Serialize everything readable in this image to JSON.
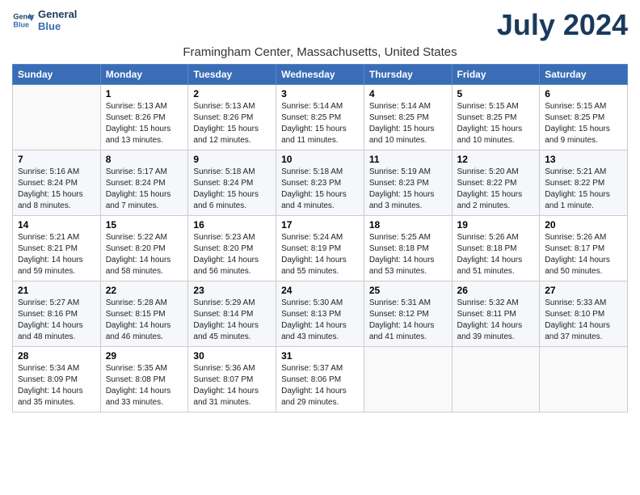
{
  "header": {
    "logo_line1": "General",
    "logo_line2": "Blue",
    "month_title": "July 2024",
    "location": "Framingham Center, Massachusetts, United States"
  },
  "days_of_week": [
    "Sunday",
    "Monday",
    "Tuesday",
    "Wednesday",
    "Thursday",
    "Friday",
    "Saturday"
  ],
  "weeks": [
    [
      {
        "day": "",
        "details": ""
      },
      {
        "day": "1",
        "details": "Sunrise: 5:13 AM\nSunset: 8:26 PM\nDaylight: 15 hours\nand 13 minutes."
      },
      {
        "day": "2",
        "details": "Sunrise: 5:13 AM\nSunset: 8:26 PM\nDaylight: 15 hours\nand 12 minutes."
      },
      {
        "day": "3",
        "details": "Sunrise: 5:14 AM\nSunset: 8:25 PM\nDaylight: 15 hours\nand 11 minutes."
      },
      {
        "day": "4",
        "details": "Sunrise: 5:14 AM\nSunset: 8:25 PM\nDaylight: 15 hours\nand 10 minutes."
      },
      {
        "day": "5",
        "details": "Sunrise: 5:15 AM\nSunset: 8:25 PM\nDaylight: 15 hours\nand 10 minutes."
      },
      {
        "day": "6",
        "details": "Sunrise: 5:15 AM\nSunset: 8:25 PM\nDaylight: 15 hours\nand 9 minutes."
      }
    ],
    [
      {
        "day": "7",
        "details": "Sunrise: 5:16 AM\nSunset: 8:24 PM\nDaylight: 15 hours\nand 8 minutes."
      },
      {
        "day": "8",
        "details": "Sunrise: 5:17 AM\nSunset: 8:24 PM\nDaylight: 15 hours\nand 7 minutes."
      },
      {
        "day": "9",
        "details": "Sunrise: 5:18 AM\nSunset: 8:24 PM\nDaylight: 15 hours\nand 6 minutes."
      },
      {
        "day": "10",
        "details": "Sunrise: 5:18 AM\nSunset: 8:23 PM\nDaylight: 15 hours\nand 4 minutes."
      },
      {
        "day": "11",
        "details": "Sunrise: 5:19 AM\nSunset: 8:23 PM\nDaylight: 15 hours\nand 3 minutes."
      },
      {
        "day": "12",
        "details": "Sunrise: 5:20 AM\nSunset: 8:22 PM\nDaylight: 15 hours\nand 2 minutes."
      },
      {
        "day": "13",
        "details": "Sunrise: 5:21 AM\nSunset: 8:22 PM\nDaylight: 15 hours\nand 1 minute."
      }
    ],
    [
      {
        "day": "14",
        "details": "Sunrise: 5:21 AM\nSunset: 8:21 PM\nDaylight: 14 hours\nand 59 minutes."
      },
      {
        "day": "15",
        "details": "Sunrise: 5:22 AM\nSunset: 8:20 PM\nDaylight: 14 hours\nand 58 minutes."
      },
      {
        "day": "16",
        "details": "Sunrise: 5:23 AM\nSunset: 8:20 PM\nDaylight: 14 hours\nand 56 minutes."
      },
      {
        "day": "17",
        "details": "Sunrise: 5:24 AM\nSunset: 8:19 PM\nDaylight: 14 hours\nand 55 minutes."
      },
      {
        "day": "18",
        "details": "Sunrise: 5:25 AM\nSunset: 8:18 PM\nDaylight: 14 hours\nand 53 minutes."
      },
      {
        "day": "19",
        "details": "Sunrise: 5:26 AM\nSunset: 8:18 PM\nDaylight: 14 hours\nand 51 minutes."
      },
      {
        "day": "20",
        "details": "Sunrise: 5:26 AM\nSunset: 8:17 PM\nDaylight: 14 hours\nand 50 minutes."
      }
    ],
    [
      {
        "day": "21",
        "details": "Sunrise: 5:27 AM\nSunset: 8:16 PM\nDaylight: 14 hours\nand 48 minutes."
      },
      {
        "day": "22",
        "details": "Sunrise: 5:28 AM\nSunset: 8:15 PM\nDaylight: 14 hours\nand 46 minutes."
      },
      {
        "day": "23",
        "details": "Sunrise: 5:29 AM\nSunset: 8:14 PM\nDaylight: 14 hours\nand 45 minutes."
      },
      {
        "day": "24",
        "details": "Sunrise: 5:30 AM\nSunset: 8:13 PM\nDaylight: 14 hours\nand 43 minutes."
      },
      {
        "day": "25",
        "details": "Sunrise: 5:31 AM\nSunset: 8:12 PM\nDaylight: 14 hours\nand 41 minutes."
      },
      {
        "day": "26",
        "details": "Sunrise: 5:32 AM\nSunset: 8:11 PM\nDaylight: 14 hours\nand 39 minutes."
      },
      {
        "day": "27",
        "details": "Sunrise: 5:33 AM\nSunset: 8:10 PM\nDaylight: 14 hours\nand 37 minutes."
      }
    ],
    [
      {
        "day": "28",
        "details": "Sunrise: 5:34 AM\nSunset: 8:09 PM\nDaylight: 14 hours\nand 35 minutes."
      },
      {
        "day": "29",
        "details": "Sunrise: 5:35 AM\nSunset: 8:08 PM\nDaylight: 14 hours\nand 33 minutes."
      },
      {
        "day": "30",
        "details": "Sunrise: 5:36 AM\nSunset: 8:07 PM\nDaylight: 14 hours\nand 31 minutes."
      },
      {
        "day": "31",
        "details": "Sunrise: 5:37 AM\nSunset: 8:06 PM\nDaylight: 14 hours\nand 29 minutes."
      },
      {
        "day": "",
        "details": ""
      },
      {
        "day": "",
        "details": ""
      },
      {
        "day": "",
        "details": ""
      }
    ]
  ]
}
